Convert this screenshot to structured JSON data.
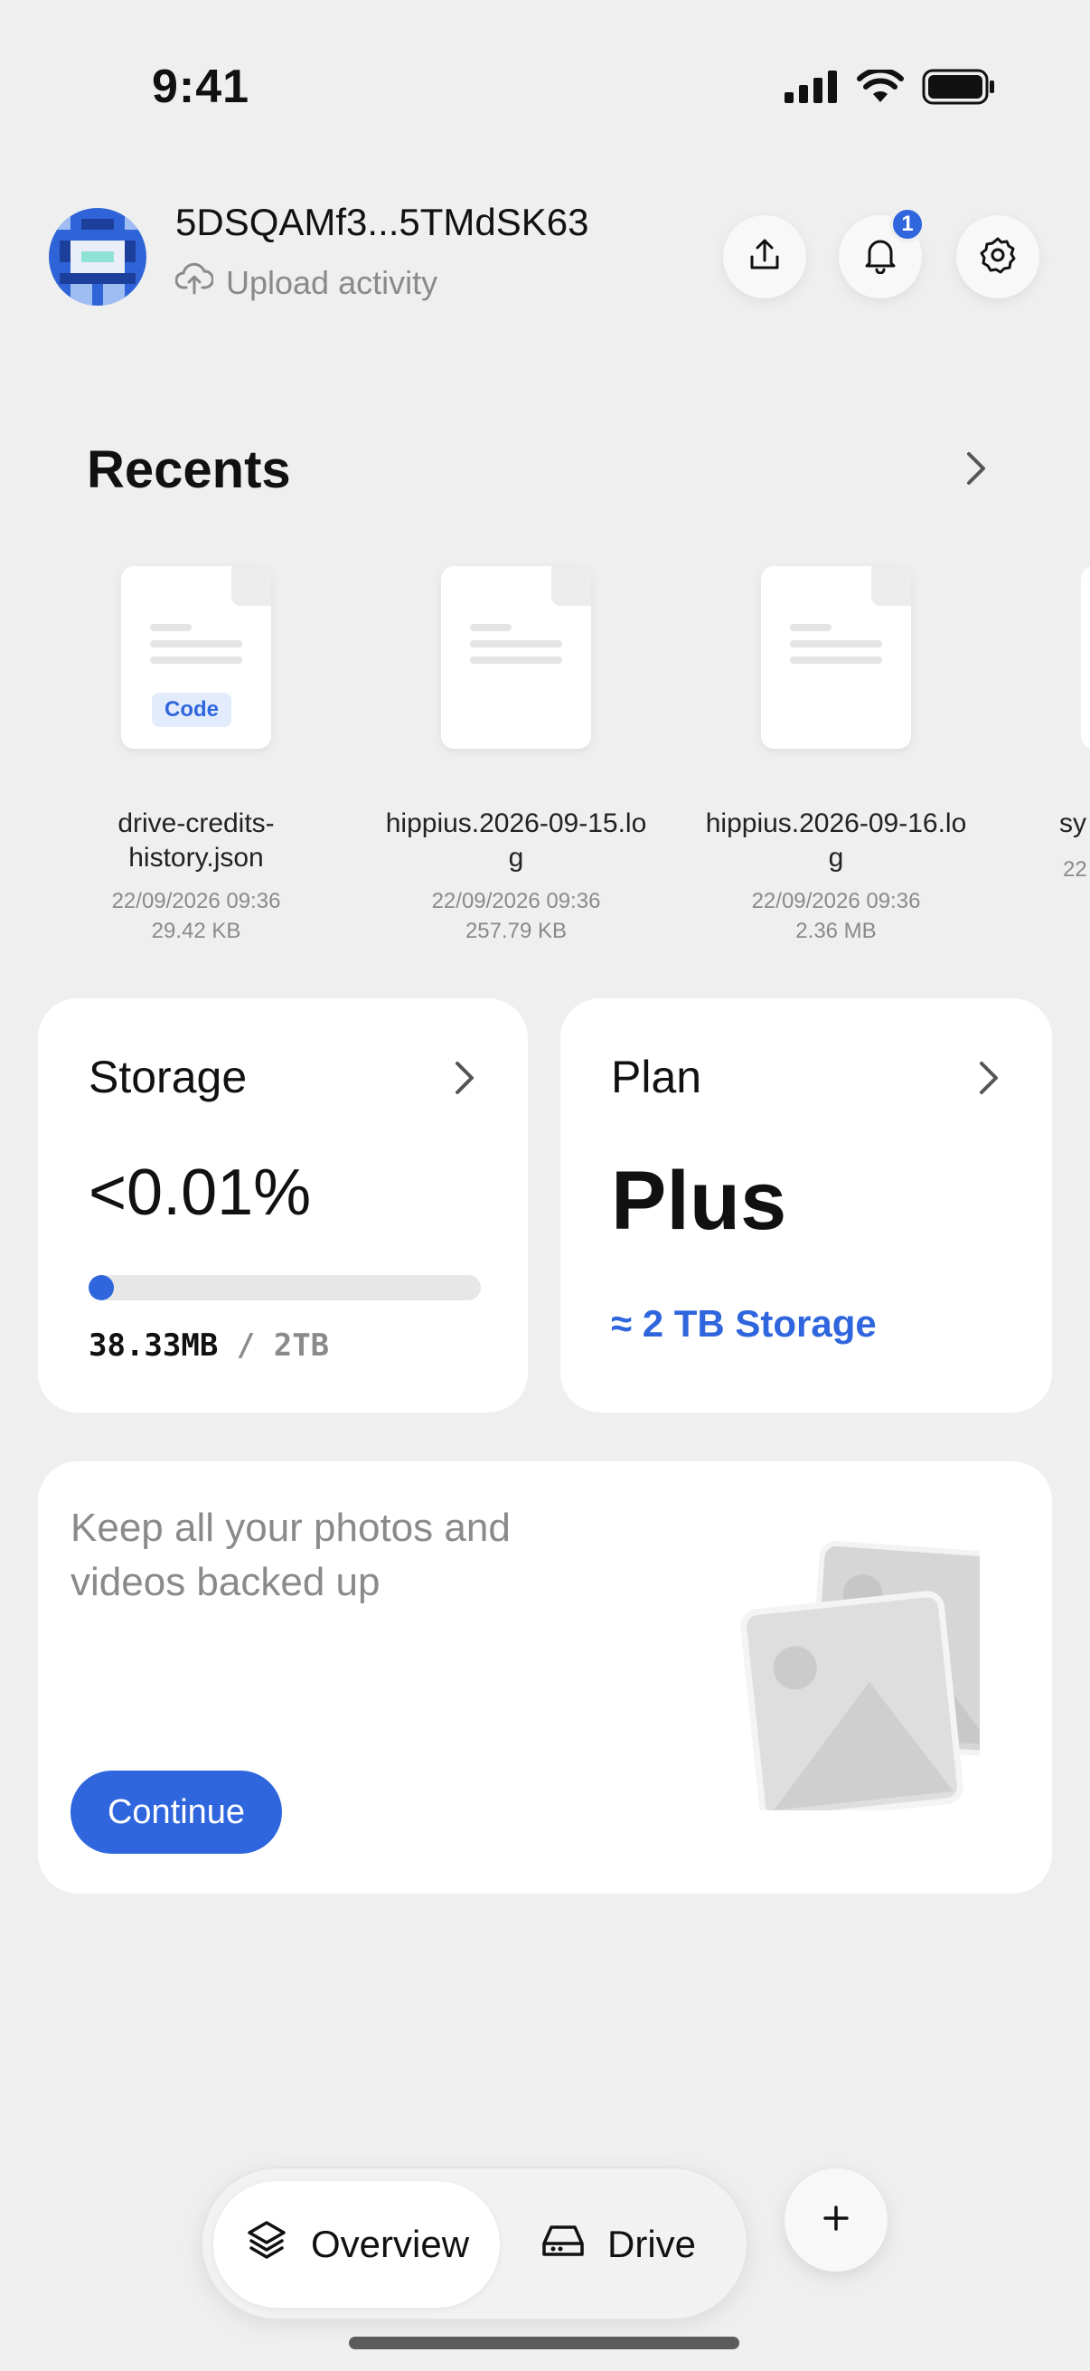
{
  "status_bar": {
    "time": "9:41",
    "icons": [
      "cellular-signal-icon",
      "wifi-icon",
      "battery-icon"
    ]
  },
  "header": {
    "account_id": "5DSQAMf3...5TMdSK63",
    "subtitle": "Upload activity",
    "subtitle_icon": "cloud-upload-icon",
    "actions": [
      {
        "icon": "share-upload-icon"
      },
      {
        "icon": "bell-icon",
        "badge": "1"
      },
      {
        "icon": "gear-icon"
      }
    ]
  },
  "recents": {
    "title": "Recents",
    "files": [
      {
        "name": "drive-credits-history.json",
        "name_lines": [
          "drive-credits-",
          "history.json"
        ],
        "tag": "Code",
        "date": "22/09/2026 09:36",
        "size": "29.42 KB"
      },
      {
        "name": "hippius.2026-09-15.log",
        "name_lines": [
          "hippius.2026-09-15.lo",
          "g"
        ],
        "tag": "",
        "date": "22/09/2026 09:36",
        "size": "257.79 KB"
      },
      {
        "name": "hippius.2026-09-16.log",
        "name_lines": [
          "hippius.2026-09-16.lo",
          "g"
        ],
        "tag": "",
        "date": "22/09/2026 09:36",
        "size": "2.36 MB"
      },
      {
        "name": "sy",
        "name_lines": [
          "sy",
          ""
        ],
        "tag": "",
        "date": "22",
        "size": ""
      }
    ]
  },
  "storage": {
    "title": "Storage",
    "percent": "<0.01%",
    "used_fraction": 0.0001,
    "used": "38.33MB",
    "separator": " / ",
    "total": "2TB"
  },
  "plan": {
    "title": "Plan",
    "name": "Plus",
    "storage": "≈ 2 TB Storage"
  },
  "backup": {
    "text": "Keep all your photos and videos backed up",
    "button": "Continue"
  },
  "tabbar": {
    "tabs": [
      {
        "label": "Overview",
        "icon": "layers-icon",
        "active": true
      },
      {
        "label": "Drive",
        "icon": "hard-drive-icon",
        "active": false
      }
    ],
    "fab_icon": "plus-icon"
  },
  "colors": {
    "accent": "#2f66de",
    "background": "#efefef",
    "card": "#ffffff",
    "muted_text": "#8a8a8a"
  }
}
